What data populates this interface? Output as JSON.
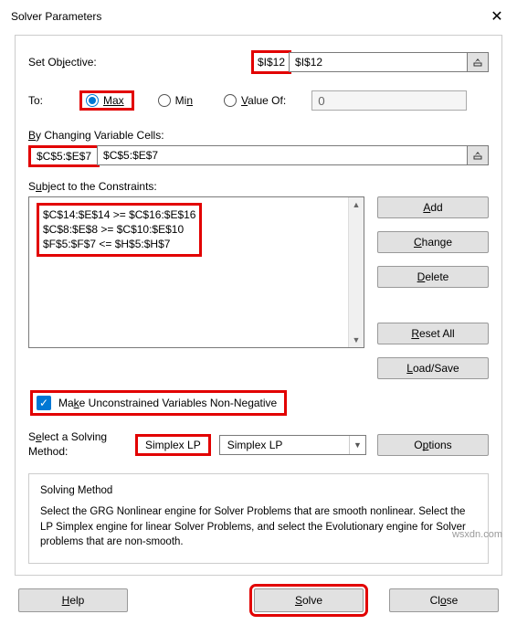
{
  "window": {
    "title": "Solver Parameters",
    "close": "✕"
  },
  "objective": {
    "label": "Set Objective:",
    "value": "$I$12"
  },
  "to": {
    "label": "To:",
    "options": {
      "max": "Max",
      "min": "Min",
      "valueOf": "Value Of:"
    },
    "valueOfInput": "0"
  },
  "changingCells": {
    "label": "By Changing Variable Cells:",
    "value": "$C$5:$E$7"
  },
  "constraints": {
    "label": "Subject to the Constraints:",
    "lines": [
      "$C$14:$E$14 >= $C$16:$E$16",
      "$C$8:$E$8 >= $C$10:$E$10",
      "$F$5:$F$7 <= $H$5:$H$7"
    ],
    "buttons": {
      "add": "Add",
      "change": "Change",
      "delete": "Delete",
      "resetAll": "Reset All",
      "loadSave": "Load/Save"
    }
  },
  "nonNegative": "Make Unconstrained Variables Non-Negative",
  "method": {
    "label": "Select a Solving Method:",
    "value": "Simplex LP",
    "optionsBtn": "Options"
  },
  "helpGroup": {
    "title": "Solving Method",
    "body": "Select the GRG Nonlinear engine for Solver Problems that are smooth nonlinear. Select the LP Simplex engine for linear Solver Problems, and select the Evolutionary engine for Solver problems that are non-smooth."
  },
  "bottom": {
    "help": "Help",
    "solve": "Solve",
    "close": "Close"
  },
  "watermark": "wsxdn.com"
}
